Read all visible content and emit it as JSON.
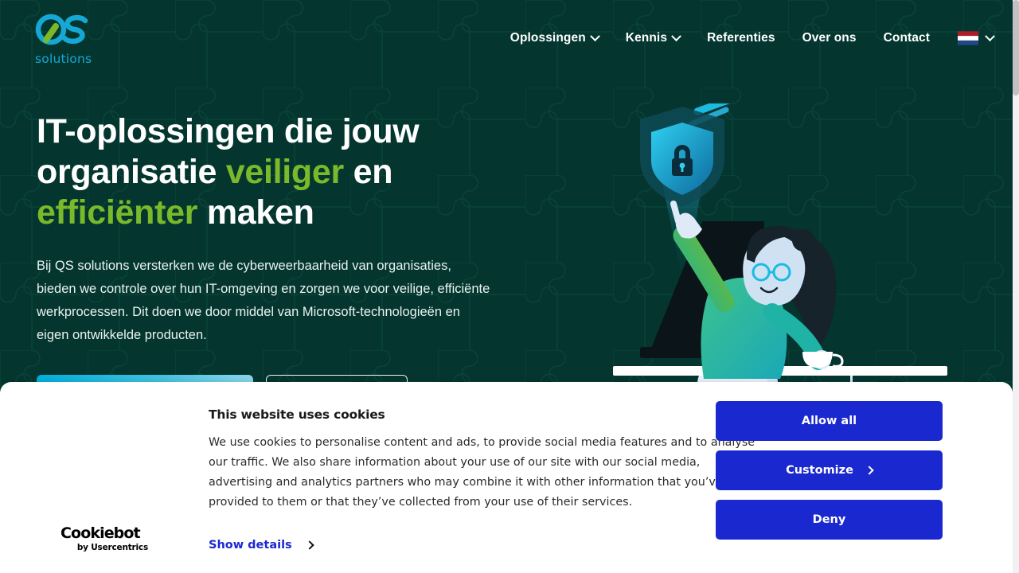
{
  "brand": {
    "logo_mark": "QS",
    "logo_word": "solutions",
    "logo_alt": "qs-solutions-logo",
    "cyan": "#15a8d4",
    "green": "#7ab929"
  },
  "nav": {
    "items": [
      {
        "label": "Oplossingen",
        "has_dropdown": true,
        "icon": "chevron-down-icon"
      },
      {
        "label": "Kennis",
        "has_dropdown": true,
        "icon": "chevron-down-icon"
      },
      {
        "label": "Referenties",
        "has_dropdown": false,
        "icon": ""
      },
      {
        "label": "Over ons",
        "has_dropdown": false,
        "icon": ""
      },
      {
        "label": "Contact",
        "has_dropdown": false,
        "icon": ""
      }
    ],
    "language": {
      "current": "nl",
      "flag_icon": "flag-netherlands-icon",
      "chevron_icon": "chevron-down-icon",
      "flag_colors": [
        "#AE1C28",
        "#FFFFFF",
        "#21468B"
      ]
    }
  },
  "hero": {
    "title_parts": [
      {
        "text": "IT-oplossingen die jouw",
        "accent": false
      },
      {
        "text": "organisatie ",
        "accent": false
      },
      {
        "text": "veiliger",
        "accent": true
      },
      {
        "text": " en",
        "accent": false
      },
      {
        "text": "efficiënter",
        "accent": true
      },
      {
        "text": " maken",
        "accent": false
      }
    ],
    "title_plain": "IT-oplossingen die jouw organisatie veiliger en efficiënter maken",
    "paragraph": "Bij QS solutions versterken we de cyberweerbaarheid van organisaties, bieden we controle over hun IT-omgeving en zorgen we voor veilige, efficiënte werkprocessen. Dit doen we door middel van Microsoft-technologieën en eigen ontwikkelde producten.",
    "cta_primary": "",
    "cta_secondary": "",
    "illustration": "woman-at-desk-with-shield-lock-illustration",
    "background_pattern": "jigsaw-puzzle-pattern",
    "background_color": "#04362F",
    "accent_green": "#7AB929",
    "accent_cyan": "#00AEDB"
  },
  "cookie_banner": {
    "title": "This website uses cookies",
    "description": "We use cookies to personalise content and ads, to provide social media features and to analyse our traffic. We also share information about your use of our site with our social media, advertising and analytics partners who may combine it with other information that you’ve provided to them or that they’ve collected from your use of their services.",
    "buttons": [
      {
        "label": "Allow all",
        "icon": ""
      },
      {
        "label": "Customize",
        "icon": "chevron-right-icon"
      },
      {
        "label": "Deny",
        "icon": ""
      }
    ],
    "button_color": "#1A28CF",
    "show_details_label": "Show details",
    "show_details_icon": "chevron-right-icon",
    "provider_name": "Cookiebot",
    "provider_sub": "by Usercentrics"
  }
}
